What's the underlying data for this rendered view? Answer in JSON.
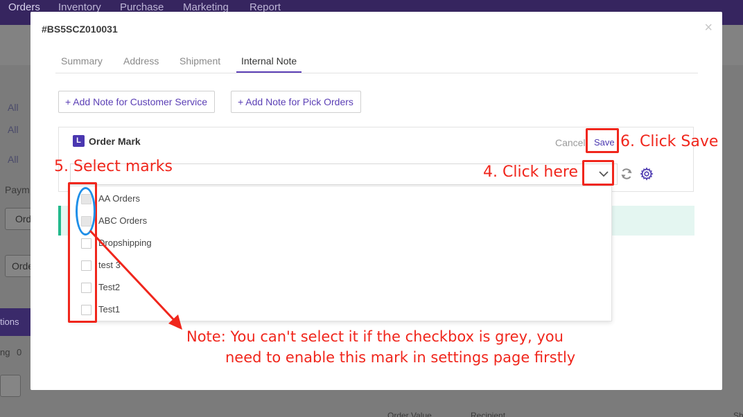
{
  "app_nav": {
    "items": [
      "Orders",
      "Inventory",
      "Purchase",
      "Marketing",
      "Report"
    ]
  },
  "background": {
    "filter_all_1": "All",
    "filter_all_2": "All",
    "filter_all_3": "All",
    "payment_label": "Paym",
    "select_1": "Ord",
    "select_2": "Orde",
    "actions_label": "tions",
    "paging_label": "ng",
    "paging_count": "0",
    "col_order_value": "Order Value",
    "col_recipient": "Recipient",
    "col_sh": "Sh"
  },
  "modal": {
    "order_number": "#BS5SCZ010031",
    "close_symbol": "×",
    "tabs": [
      {
        "label": "Summary",
        "active": false
      },
      {
        "label": "Address",
        "active": false
      },
      {
        "label": "Shipment",
        "active": false
      },
      {
        "label": "Internal Note",
        "active": true
      }
    ],
    "add_note_customer_service": "+ Add Note for Customer Service",
    "add_note_pick_orders": "+ Add Note for Pick Orders",
    "order_mark": {
      "icon_letter": "L",
      "title": "Order Mark",
      "cancel_label": "Cancel",
      "save_label": "Save",
      "selected_value": "",
      "options": [
        {
          "label": "AA Orders",
          "checked": false,
          "disabled": true
        },
        {
          "label": "ABC Orders",
          "checked": false,
          "disabled": true
        },
        {
          "label": "Dropshipping",
          "checked": false,
          "disabled": false
        },
        {
          "label": "test 3",
          "checked": false,
          "disabled": false
        },
        {
          "label": "Test2",
          "checked": false,
          "disabled": false
        },
        {
          "label": "Test1",
          "checked": false,
          "disabled": false
        }
      ]
    }
  },
  "annotations": {
    "step4": "4. Click here",
    "step5": "5. Select marks",
    "step6": "6. Click Save",
    "note_line1": "Note: You can't select it if the checkbox is grey, you",
    "note_line2": "need to enable this mark in settings page firstly"
  },
  "colors": {
    "brand_purple": "#4a37b0",
    "annotation_red": "#f0261c",
    "annotation_blue": "#1f8fe8",
    "note_green": "#23b98c"
  },
  "icons": {
    "chevron": "chevron-down-icon",
    "refresh": "refresh-icon",
    "settings": "gear-icon",
    "close": "close-icon"
  }
}
